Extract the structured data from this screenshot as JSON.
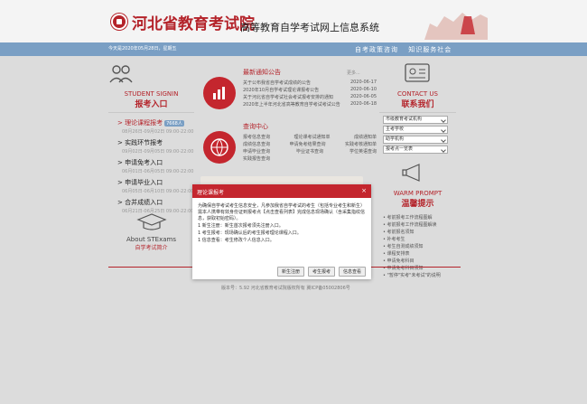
{
  "header": {
    "brand": "河北省教育考试院",
    "system_title": "高等教育自学考试网上信息系统"
  },
  "navbar": {
    "date_text": "今天是2020年05月28日，星期五",
    "links": [
      "自考政策咨询",
      "知识服务社会"
    ]
  },
  "left": {
    "en_title": "STUDENT SIGNIN",
    "cn_title": "报考入口",
    "entrances": [
      {
        "label": "理论课程报考",
        "sub": "08月26日-09月02日 09:00-22:00",
        "tag": "7668人",
        "active": true
      },
      {
        "label": "实践环节报考",
        "sub": "09月02日-09月05日 09:00-22:00"
      },
      {
        "label": "申请免考入口",
        "sub": "06月01日-06月05日 09:00-22:00"
      },
      {
        "label": "申请毕业入口",
        "sub": "06月05日-06月10日 09:00-22:00"
      },
      {
        "label": "合并成绩入口",
        "sub": "06月21日-06月25日 09:00-22:00"
      }
    ],
    "about_en": "About STExams",
    "about_cn": "自学考试简介"
  },
  "middle": {
    "news_title": "最新通知公告",
    "more": "更多...",
    "news": [
      {
        "title": "关于公布我省自学考试成绩的公告",
        "date": "2020-06-17"
      },
      {
        "title": "2020年10月自学考试理论课报考公告",
        "date": "2020-06-10"
      },
      {
        "title": "关于河北省自学考试社会考试报考安排的通知",
        "date": "2020-06-05"
      },
      {
        "title": "2020年上半年河北省高等教育自学考试考试公告",
        "date": "2020-06-18"
      }
    ],
    "query_title": "查询中心",
    "links": [
      [
        "报考信息查询",
        "理论课考试通知单",
        "成绩通知单"
      ],
      [
        "成绩信息查询",
        "申请免考结果查询",
        "实践考核通知单"
      ],
      [
        "申请毕业查询",
        "毕业证书查询",
        "学位英语查询"
      ],
      [
        "实践报告查询",
        "",
        ""
      ]
    ]
  },
  "right": {
    "en_title": "CONTACT US",
    "cn_title": "联系我们",
    "selects": [
      "市级教育考试机构",
      "主考学校",
      "助学机构",
      "报考点一览表"
    ],
    "prompt_en": "WARM PROMPT",
    "prompt_cn": "温馨提示",
    "prompts": [
      "考前报考工作流程图解",
      "考前报考工作流程图解读",
      "考前报名须知",
      "补考考生",
      "考生自测成绩须知",
      "课程安排表",
      "申请免考科目",
      "申请免考科目须知",
      "\"暂停\"实考\"未考试\"的说明"
    ]
  },
  "footer": {
    "text": "版本号：5.92 河北省教育考试院版权所有 冀ICP备05002806号"
  },
  "modal": {
    "title": "理论课报考",
    "close": "×",
    "paragraphs": [
      "为确保自学考试考生信息安全，凡参加我省自学考试的考生（包括专业考生和新生）需本人携带有效身份证到报考点【点击查看列表】完成信息现场确认（含采集指纹信息，获取初始密码）。",
      "1 新生注册：新生首次报考须先注册入口。",
      "1 考生报考：现场确认后的考生报考理论课程入口。",
      "1 信息查看：考生修改个人信息入口。"
    ],
    "buttons": [
      "新生注册",
      "考生报考",
      "信息查看"
    ]
  }
}
